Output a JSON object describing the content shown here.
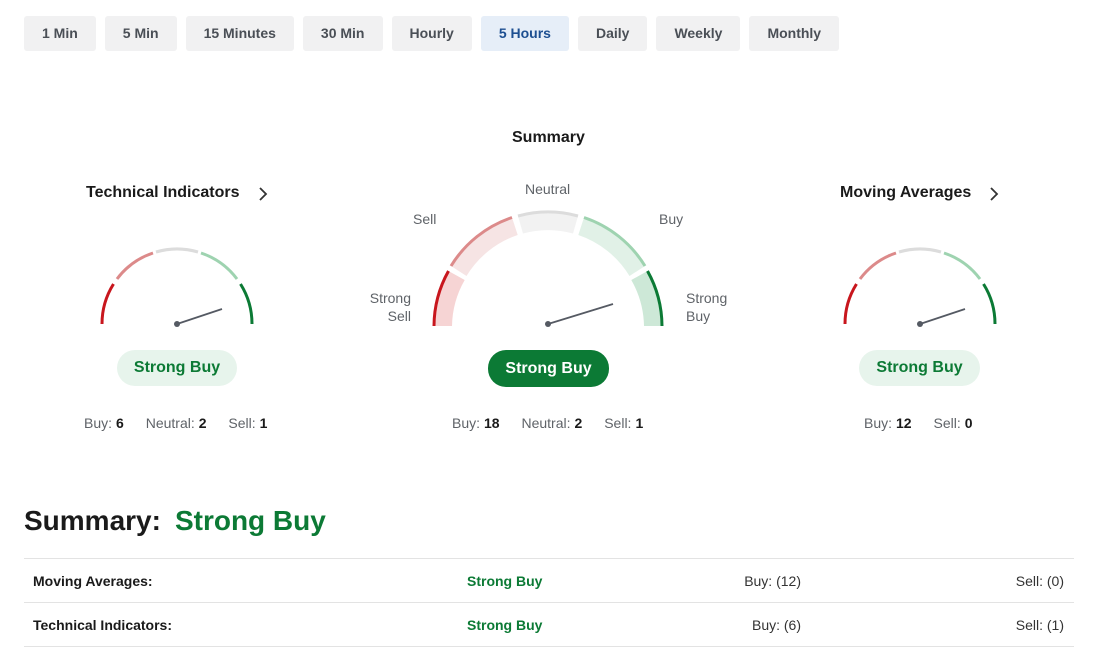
{
  "timeframes": [
    "1 Min",
    "5 Min",
    "15 Minutes",
    "30 Min",
    "Hourly",
    "5 Hours",
    "Daily",
    "Weekly",
    "Monthly"
  ],
  "active_timeframe": "5 Hours",
  "technical_indicators": {
    "title": "Technical Indicators",
    "status": "Strong Buy",
    "buy_label": "Buy:",
    "buy": "6",
    "neutral_label": "Neutral:",
    "neutral": "2",
    "sell_label": "Sell:",
    "sell": "1"
  },
  "summary_gauge": {
    "title": "Summary",
    "labels": {
      "neutral": "Neutral",
      "sell": "Sell",
      "buy": "Buy",
      "strong_sell_1": "Strong",
      "strong_sell_2": "Sell",
      "strong_buy_1": "Strong",
      "strong_buy_2": "Buy"
    },
    "status": "Strong Buy",
    "buy_label": "Buy:",
    "buy": "18",
    "neutral_label": "Neutral:",
    "neutral": "2",
    "sell_label": "Sell:",
    "sell": "1"
  },
  "moving_averages": {
    "title": "Moving Averages",
    "status": "Strong Buy",
    "buy_label": "Buy:",
    "buy": "12",
    "sell_label": "Sell:",
    "sell": "0"
  },
  "summary": {
    "label": "Summary:",
    "value": "Strong Buy"
  },
  "table": [
    {
      "name": "Moving Averages:",
      "signal": "Strong Buy",
      "buy": "Buy: (12)",
      "sell": "Sell: (0)"
    },
    {
      "name": "Technical Indicators:",
      "signal": "Strong Buy",
      "buy": "Buy: (6)",
      "sell": "Sell: (1)"
    }
  ],
  "colors": {
    "strong_sell": "#c8161d",
    "sell": "#dc8a8a",
    "neutral": "#dcdcdc",
    "buy": "#9ed3b0",
    "strong_buy": "#0c7a35",
    "accent": "#1d4f91"
  }
}
